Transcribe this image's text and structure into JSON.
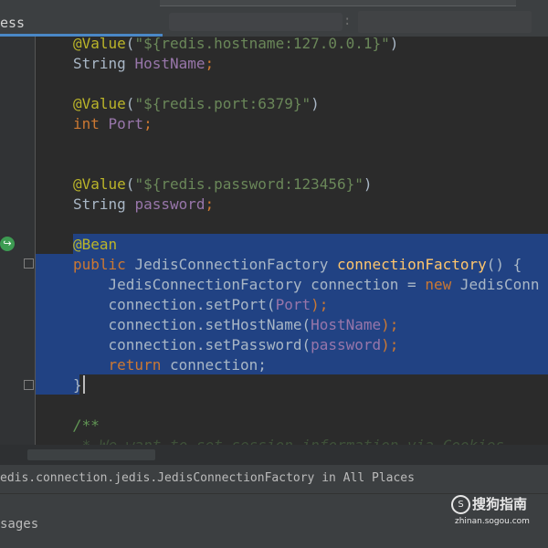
{
  "tabbar": {
    "active_tab": "ess",
    "separator": ":"
  },
  "editor": {
    "lines": [
      [
        "@Value",
        "(",
        "\"${redis.hostname:127.0.0.1}\"",
        ")"
      ],
      [
        "String ",
        "HostName",
        ";"
      ],
      [
        "@Value",
        "(",
        "\"${redis.port:6379}\"",
        ")"
      ],
      [
        "int ",
        "Port",
        ";"
      ],
      [
        "@Value",
        "(",
        "\"${redis.password:123456}\"",
        ")"
      ],
      [
        "String ",
        "password",
        ";"
      ],
      [
        "@Bean"
      ],
      [
        "public ",
        "JedisConnectionFactory ",
        "connectionFactory",
        "() {"
      ],
      [
        "    JedisConnectionFactory connection = ",
        "new ",
        "JedisConn"
      ],
      [
        "    connection.setPort(",
        "Port",
        ");"
      ],
      [
        "    connection.setHostName(",
        "HostName",
        ");"
      ],
      [
        "    connection.setPassword(",
        "password",
        ");"
      ],
      [
        "    ",
        "return ",
        "connection;"
      ],
      [
        "}"
      ],
      [
        "/**"
      ],
      [
        " * We want to set session information via Cookies"
      ]
    ]
  },
  "gutter": {
    "bean_icon": "spring-bean-icon",
    "fold_icon": "fold-marker-icon"
  },
  "find": {
    "text": "edis.connection.jedis.JedisConnectionFactory in All Places"
  },
  "usages": {
    "label": "sages"
  },
  "watermark": {
    "title": "搜狗指南",
    "subtitle": "zhinan.sogou.com"
  },
  "colors": {
    "background": "#2b2b2b",
    "selection": "#214283",
    "annotation": "#bbb529",
    "string": "#6a8759",
    "keyword": "#cc7832",
    "field": "#9876aa",
    "method": "#ffc66d"
  }
}
